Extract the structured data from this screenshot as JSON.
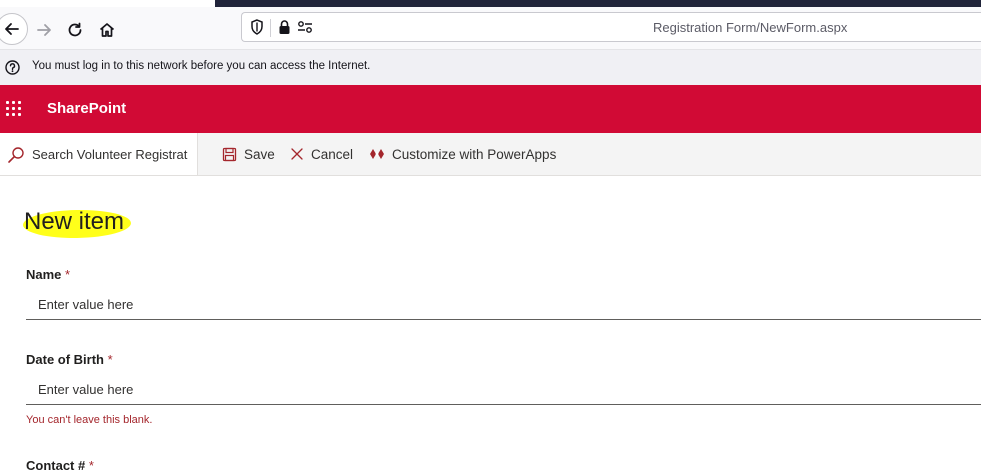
{
  "browser": {
    "url": "Registration Form/NewForm.aspx"
  },
  "notice": {
    "text": "You must log in to this network before you can access the Internet."
  },
  "suitebar": {
    "brand": "SharePoint",
    "accent": "#d10a35"
  },
  "commandbar": {
    "search_placeholder": "Search Volunteer Registrat",
    "save_label": "Save",
    "cancel_label": "Cancel",
    "customize_label": "Customize with PowerApps"
  },
  "form": {
    "title": "New item",
    "required_marker": "*",
    "fields": [
      {
        "label": "Name",
        "placeholder": "Enter value here"
      },
      {
        "label": "Date of Birth",
        "placeholder": "Enter value here",
        "error": "You can't leave this blank."
      },
      {
        "label": "Contact #"
      }
    ]
  },
  "icons": {
    "back": "back-arrow-icon",
    "forward": "forward-arrow-icon",
    "reload": "reload-icon",
    "home": "home-icon",
    "shield": "shield-icon",
    "lock": "lock-icon",
    "permissions": "permissions-icon",
    "help": "help-circle-icon",
    "waffle": "app-launcher-icon",
    "search": "search-icon",
    "save": "floppy-disk-icon",
    "cancel": "close-icon",
    "powerapps": "powerapps-icon"
  }
}
